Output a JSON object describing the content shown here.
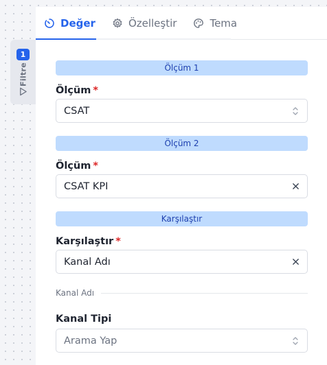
{
  "filter": {
    "badge": "1",
    "label": "Filtre"
  },
  "tabs": [
    {
      "label": "Değer",
      "icon": "gauge-icon"
    },
    {
      "label": "Özelleştir",
      "icon": "gear-icon"
    },
    {
      "label": "Tema",
      "icon": "palette-icon"
    }
  ],
  "sections": {
    "metric1_header": "Ölçüm 1",
    "metric2_header": "Ölçüm 2",
    "compare_header": "Karşılaştır"
  },
  "fields": {
    "metric1": {
      "label": "Ölçüm",
      "required": "*",
      "value": "CSAT"
    },
    "metric2": {
      "label": "Ölçüm",
      "required": "*",
      "value": "CSAT KPI"
    },
    "compare": {
      "label": "Karşılaştır",
      "required": "*",
      "value": "Kanal Adı"
    },
    "channel_type": {
      "label": "Kanal Tipi",
      "placeholder": "Arama Yap"
    }
  },
  "divider_label": "Kanal Adı",
  "colors": {
    "accent": "#2563eb",
    "section_bg": "#bfdbfe",
    "required": "#dc2626"
  }
}
